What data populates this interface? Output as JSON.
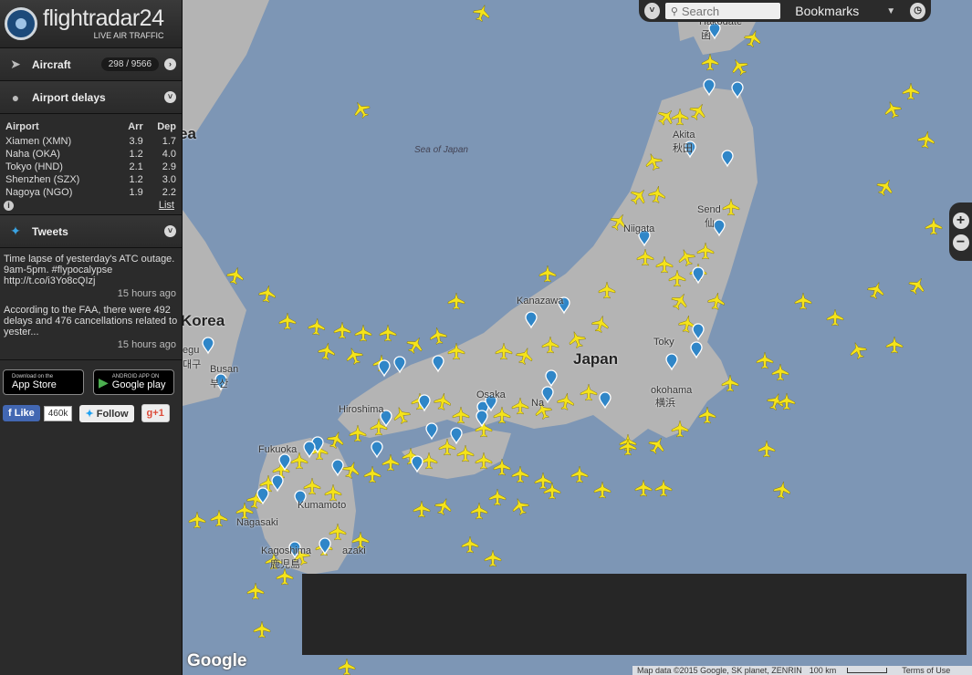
{
  "app": {
    "name": "flightradar24",
    "tagline": "LIVE AIR TRAFFIC"
  },
  "sidebar": {
    "aircraft": {
      "label": "Aircraft",
      "count": "298 / 9566"
    },
    "airport_delays": {
      "label": "Airport delays",
      "columns": [
        "Airport",
        "Arr",
        "Dep"
      ],
      "rows": [
        {
          "airport": "Xiamen (XMN)",
          "arr": "3.9",
          "dep": "1.7"
        },
        {
          "airport": "Naha (OKA)",
          "arr": "1.2",
          "dep": "4.0"
        },
        {
          "airport": "Tokyo (HND)",
          "arr": "2.1",
          "dep": "2.9"
        },
        {
          "airport": "Shenzhen (SZX)",
          "arr": "1.2",
          "dep": "3.0"
        },
        {
          "airport": "Nagoya (NGO)",
          "arr": "1.9",
          "dep": "2.2"
        }
      ],
      "list_link": "List"
    },
    "tweets": {
      "label": "Tweets",
      "items": [
        {
          "text": "Time lapse of yesterday's ATC outage. 9am-5pm. #flypocalypse http://t.co/i3Yo8cQIzj",
          "time": "15 hours ago"
        },
        {
          "text": "According to the FAA, there were 492 delays and 476 cancellations related to yester...",
          "time": "15 hours ago"
        }
      ]
    },
    "stores": {
      "appstore_small": "Download on the",
      "appstore_big": "App Store",
      "google_small": "ANDROID APP ON",
      "google_big": "Google play"
    },
    "social": {
      "like": "Like",
      "like_count": "460k",
      "follow": "Follow",
      "gplus": "+1"
    }
  },
  "toolbar": {
    "search_placeholder": "Search",
    "bookmarks": "Bookmarks"
  },
  "map": {
    "labels": {
      "sea_of_japan": "Sea of Japan",
      "korea": "Korea",
      "japan": "Japan",
      "sea_partial": "ea",
      "busan": "Busan",
      "daegu": "egu",
      "daegu_kr": "대구",
      "busan_kr": "부산",
      "hiroshima": "Hiroshima",
      "fukuoka": "Fukuoka",
      "kumamoto": "Kumamoto",
      "nagasaki": "Nagasaki",
      "kagoshima": "Kagoshima",
      "kagoshima_jp": "鹿児島",
      "miyazaki": "azaki",
      "osaka": "Osaka",
      "nagoya": "Na",
      "kanazawa": "Kanazawa",
      "niigata": "Niigata",
      "akita": "Akita",
      "akita_jp": "秋田",
      "sendai": "Send",
      "sendai_jp": "仙",
      "tokyo": "Toky",
      "yokohama": "okohama",
      "yokohama_jp": "横浜",
      "hakodate": "Hakodate",
      "hakodate_jp": "函"
    },
    "google_logo": "Google",
    "attribution": "Map data ©2015 Google, SK planet, ZENRIN",
    "scale": "100 km",
    "terms": "Terms of Use"
  },
  "colors": {
    "sea": "#7d96b5",
    "land": "#b4b4b4",
    "aircraft": "#f5e31a",
    "pin": "#2f86c8",
    "panel": "#2b2b2b"
  },
  "icons": {
    "aircraft_section": "plane-cursor-icon",
    "airport_section": "map-pin-icon",
    "tweets_section": "twitter-bird-icon"
  }
}
